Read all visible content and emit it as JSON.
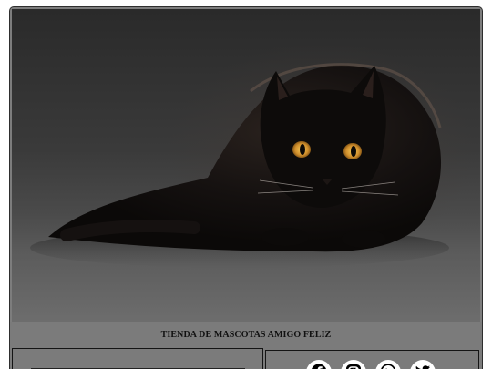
{
  "hero": {
    "image_icon": "black-cat-photo",
    "colors": {
      "background_dark": "#2a2a2a",
      "floor": "#6d6d6d",
      "cat_fur": "#0e0c0b",
      "eye": "#d7a03c"
    }
  },
  "header": {
    "store_name": "TIENDA DE MASCOTAS AMIGO FELIZ"
  },
  "footer": {
    "search_placeholder": "",
    "social_icons": [
      "facebook-icon",
      "instagram-icon",
      "whatsapp-icon",
      "twitter-icon"
    ]
  }
}
